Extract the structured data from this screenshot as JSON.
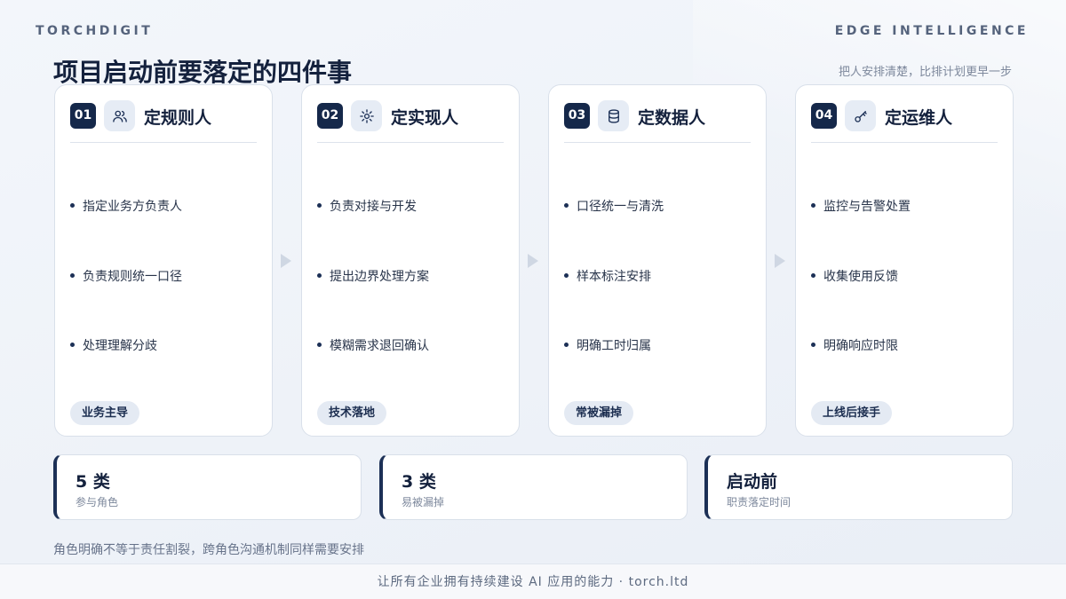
{
  "header": {
    "brand_left": "TORCHDIGIT",
    "brand_right": "EDGE INTELLIGENCE",
    "title": "项目启动前要落定的四件事",
    "subtitle": "把人安排清楚，比排计划更早一步"
  },
  "cards": [
    {
      "number": "01",
      "icon": "users-icon",
      "title": "定规则人",
      "items": [
        "指定业务方负责人",
        "负责规则统一口径",
        "处理理解分歧"
      ],
      "tag": "业务主导"
    },
    {
      "number": "02",
      "icon": "gear-icon",
      "title": "定实现人",
      "items": [
        "负责对接与开发",
        "提出边界处理方案",
        "模糊需求退回确认"
      ],
      "tag": "技术落地"
    },
    {
      "number": "03",
      "icon": "database-icon",
      "title": "定数据人",
      "items": [
        "口径统一与清洗",
        "样本标注安排",
        "明确工时归属"
      ],
      "tag": "常被漏掉"
    },
    {
      "number": "04",
      "icon": "key-icon",
      "title": "定运维人",
      "items": [
        "监控与告警处置",
        "收集使用反馈",
        "明确响应时限"
      ],
      "tag": "上线后接手"
    }
  ],
  "stats": [
    {
      "value": "5 类",
      "label": "参与角色"
    },
    {
      "value": "3 类",
      "label": "易被漏掉"
    },
    {
      "value": "启动前",
      "label": "职责落定时间"
    }
  ],
  "note": "角色明确不等于责任割裂，跨角色沟通机制同样需要安排",
  "footer": "让所有企业拥有持续建设 AI 应用的能力 · torch.ltd",
  "colors": {
    "primary": "#15284a",
    "accent_bg": "#e4eaf3",
    "card_bg": "#ffffff"
  }
}
